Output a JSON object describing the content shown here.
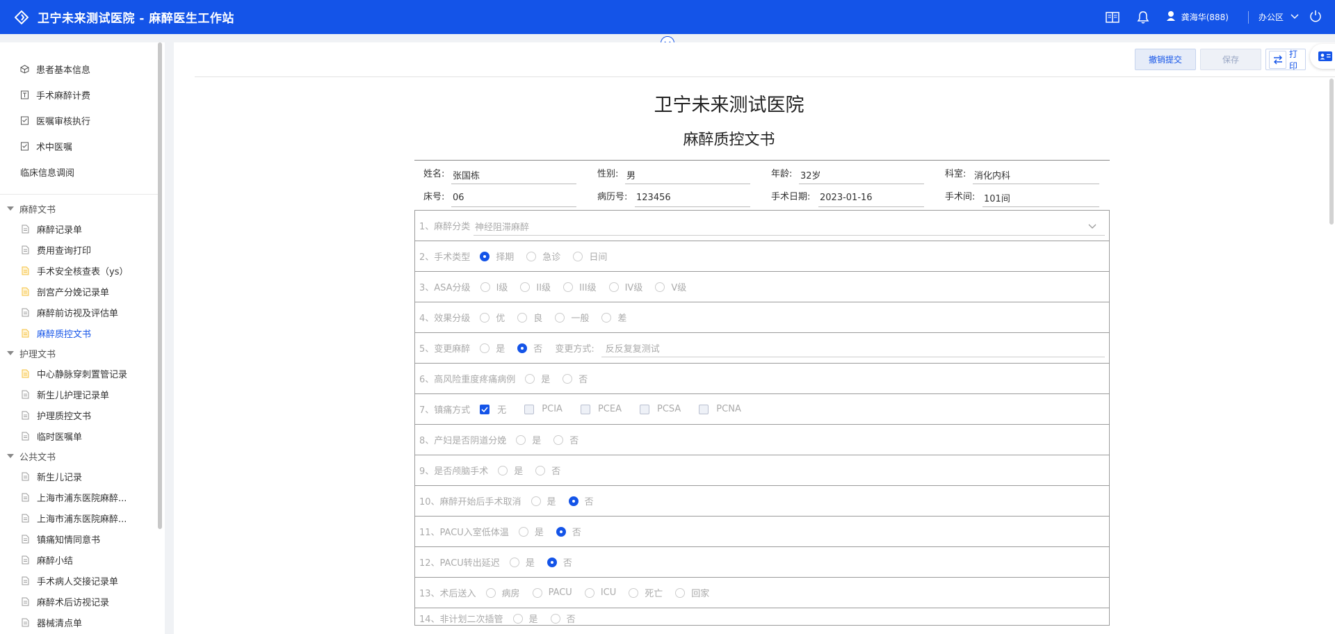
{
  "header": {
    "app_title": "卫宁未来测试医院 - 麻醉医生工作站",
    "user_name": "龚海华(888)",
    "office": "办公区",
    "icons": [
      "logo-icon",
      "book-icon",
      "bell-icon",
      "user-icon",
      "chevron-down-icon",
      "power-icon"
    ]
  },
  "sidebar": {
    "top_items": [
      {
        "label": "患者基本信息",
        "icon": "cube-icon"
      },
      {
        "label": "手术麻醉计费",
        "icon": "receipt-icon"
      },
      {
        "label": "医嘱审核执行",
        "icon": "checklist-icon"
      },
      {
        "label": "术中医嘱",
        "icon": "checklist-icon"
      },
      {
        "label": "临床信息调阅",
        "icon": ""
      }
    ],
    "groups": [
      {
        "title": "麻醉文书",
        "items": [
          {
            "label": "麻醉记录单",
            "icon": "doc-icon",
            "color": "grey"
          },
          {
            "label": "费用查询打印",
            "icon": "doc-icon",
            "color": "grey"
          },
          {
            "label": "手术安全核查表（ys）",
            "icon": "doc-icon",
            "color": "yellow"
          },
          {
            "label": "剖宫产分娩记录单",
            "icon": "doc-icon",
            "color": "yellow"
          },
          {
            "label": "麻醉前访视及评估单",
            "icon": "doc-icon",
            "color": "grey"
          },
          {
            "label": "麻醉质控文书",
            "icon": "doc-icon",
            "color": "yellow",
            "active": true
          }
        ]
      },
      {
        "title": "护理文书",
        "items": [
          {
            "label": "中心静脉穿刺置管记录",
            "icon": "doc-icon",
            "color": "yellow"
          },
          {
            "label": "新生儿护理记录单",
            "icon": "doc-icon",
            "color": "grey"
          },
          {
            "label": "护理质控文书",
            "icon": "doc-icon",
            "color": "grey"
          },
          {
            "label": "临时医嘱单",
            "icon": "doc-icon",
            "color": "grey"
          }
        ]
      },
      {
        "title": "公共文书",
        "items": [
          {
            "label": "新生儿记录",
            "icon": "doc-icon",
            "color": "grey"
          },
          {
            "label": "上海市浦东医院麻醉...",
            "icon": "doc-icon",
            "color": "grey"
          },
          {
            "label": "上海市浦东医院麻醉...",
            "icon": "doc-icon",
            "color": "grey"
          },
          {
            "label": "镇痛知情同意书",
            "icon": "doc-icon",
            "color": "grey"
          },
          {
            "label": "麻醉小结",
            "icon": "doc-icon",
            "color": "grey"
          },
          {
            "label": "手术病人交接记录单",
            "icon": "doc-icon",
            "color": "grey"
          },
          {
            "label": "麻醉术后访视记录",
            "icon": "doc-icon",
            "color": "grey"
          },
          {
            "label": "器械清点单",
            "icon": "doc-icon",
            "color": "grey"
          }
        ]
      }
    ]
  },
  "toolbar": {
    "withdraw_label": "撤销提交",
    "save_label": "保存",
    "print_label": "打印"
  },
  "document": {
    "hospital": "卫宁未来测试医院",
    "title": "麻醉质控文书",
    "patient": {
      "name_label": "姓名:",
      "name": "张国栋",
      "sex_label": "性别:",
      "sex": "男",
      "age_label": "年龄:",
      "age": "32岁",
      "dept_label": "科室:",
      "dept": "消化内科",
      "bed_label": "床号:",
      "bed": "06",
      "record_label": "病历号:",
      "record": "123456",
      "date_label": "手术日期:",
      "date": "2023-01-16",
      "room_label": "手术间:",
      "room": "101间"
    },
    "questions": [
      {
        "label": "1、麻醉分类",
        "select_value": "神经阻滞麻醉"
      },
      {
        "label": "2、手术类型",
        "options": [
          {
            "text": "择期",
            "checked": true
          },
          {
            "text": "急诊",
            "checked": false
          },
          {
            "text": "日间",
            "checked": false
          }
        ]
      },
      {
        "label": "3、ASA分级",
        "options": [
          {
            "text": "I级",
            "checked": false
          },
          {
            "text": "II级",
            "checked": false
          },
          {
            "text": "III级",
            "checked": false
          },
          {
            "text": "IV级",
            "checked": false
          },
          {
            "text": "V级",
            "checked": false
          }
        ]
      },
      {
        "label": "4、效果分级",
        "options": [
          {
            "text": "优",
            "checked": false
          },
          {
            "text": "良",
            "checked": false
          },
          {
            "text": "一般",
            "checked": false
          },
          {
            "text": "差",
            "checked": false
          }
        ]
      },
      {
        "label": "5、变更麻醉",
        "options": [
          {
            "text": "是",
            "checked": false
          },
          {
            "text": "否",
            "checked": true
          }
        ],
        "extra_label": "变更方式:",
        "extra_value": "反反复复测试"
      },
      {
        "label": "6、高风险重度疼痛病例",
        "options": [
          {
            "text": "是",
            "checked": false
          },
          {
            "text": "否",
            "checked": false
          }
        ]
      },
      {
        "label": "7、镇痛方式",
        "checkboxes": [
          {
            "text": "无",
            "checked": true
          },
          {
            "text": "PCIA",
            "checked": false
          },
          {
            "text": "PCEA",
            "checked": false
          },
          {
            "text": "PCSA",
            "checked": false
          },
          {
            "text": "PCNA",
            "checked": false
          }
        ]
      },
      {
        "label": "8、产妇是否阴道分娩",
        "options": [
          {
            "text": "是",
            "checked": false
          },
          {
            "text": "否",
            "checked": false
          }
        ]
      },
      {
        "label": "9、是否颅脑手术",
        "options": [
          {
            "text": "是",
            "checked": false
          },
          {
            "text": "否",
            "checked": false
          }
        ]
      },
      {
        "label": "10、麻醉开始后手术取消",
        "options": [
          {
            "text": "是",
            "checked": false
          },
          {
            "text": "否",
            "checked": true
          }
        ]
      },
      {
        "label": "11、PACU入室低体温",
        "options": [
          {
            "text": "是",
            "checked": false
          },
          {
            "text": "否",
            "checked": true
          }
        ]
      },
      {
        "label": "12、PACU转出延迟",
        "options": [
          {
            "text": "是",
            "checked": false
          },
          {
            "text": "否",
            "checked": true
          }
        ]
      },
      {
        "label": "13、术后送入",
        "options": [
          {
            "text": "病房",
            "checked": false
          },
          {
            "text": "PACU",
            "checked": false
          },
          {
            "text": "ICU",
            "checked": false
          },
          {
            "text": "死亡",
            "checked": false
          },
          {
            "text": "回家",
            "checked": false
          }
        ]
      },
      {
        "label": "14、非计划二次插管",
        "options": [
          {
            "text": "是",
            "checked": false
          },
          {
            "text": "否",
            "checked": false
          }
        ]
      }
    ]
  },
  "colors": {
    "accent": "#1454e8",
    "yellow_doc": "#f5c242",
    "grey_doc": "#9a9a9a"
  }
}
